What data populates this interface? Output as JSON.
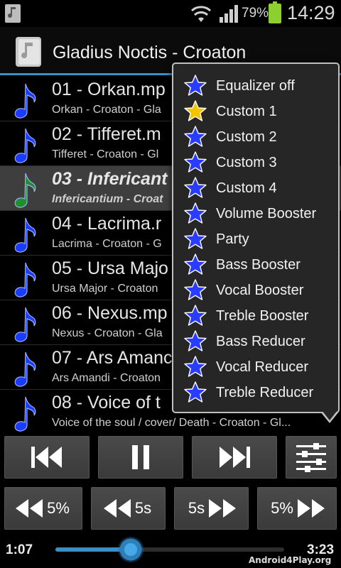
{
  "status_bar": {
    "battery": "79%",
    "time": "14:29"
  },
  "header": {
    "title": "Gladius Noctis - Croaton"
  },
  "tracks": [
    {
      "title": "01 - Orkan.mp",
      "subtitle": "Orkan - Croaton - Gla"
    },
    {
      "title": "02 - Tifferet.m",
      "subtitle": "Tifferet - Croaton - Gl"
    },
    {
      "title": "03 - Infericant",
      "subtitle": "Infericantium - Croat"
    },
    {
      "title": "04 - Lacrima.r",
      "subtitle": "Lacrima - Croaton - G"
    },
    {
      "title": "05 - Ursa Majo",
      "subtitle": "Ursa Major - Croaton"
    },
    {
      "title": "06 - Nexus.mp",
      "subtitle": "Nexus - Croaton - Gla"
    },
    {
      "title": "07 - Ars Amanc",
      "subtitle": "Ars Amandi - Croaton"
    },
    {
      "title": "08 - Voice of t",
      "subtitle": "Voice of the soul / cover/ Death - Croaton - Gl..."
    }
  ],
  "current_track_index": 2,
  "colors": {
    "note_blue": "#1a3cff",
    "note_green": "#1e8f2a",
    "accent": "#3b8fc4",
    "star_blue": "#2a3cff",
    "star_gold": "#f5c400"
  },
  "controls": {
    "prev_icon": "skip-previous-icon",
    "pause_icon": "pause-icon",
    "next_icon": "skip-next-icon",
    "equalizer_icon": "equalizer-icon",
    "rewind_pct_label": "5%",
    "rewind_sec_label": "5s",
    "forward_sec_label": "5s",
    "forward_pct_label": "5%"
  },
  "playback": {
    "elapsed": "1:07",
    "total": "3:23",
    "progress_fraction": 0.33
  },
  "equalizer_menu": {
    "items": [
      {
        "label": "Equalizer off",
        "selected": false
      },
      {
        "label": "Custom 1",
        "selected": true
      },
      {
        "label": "Custom 2",
        "selected": false
      },
      {
        "label": "Custom 3",
        "selected": false
      },
      {
        "label": "Custom 4",
        "selected": false
      },
      {
        "label": "Volume Booster",
        "selected": false
      },
      {
        "label": "Party",
        "selected": false
      },
      {
        "label": "Bass Booster",
        "selected": false
      },
      {
        "label": "Vocal Booster",
        "selected": false
      },
      {
        "label": "Treble Booster",
        "selected": false
      },
      {
        "label": "Bass Reducer",
        "selected": false
      },
      {
        "label": "Vocal Reducer",
        "selected": false
      },
      {
        "label": "Treble Reducer",
        "selected": false
      }
    ]
  },
  "watermark": "Android4Play.org"
}
